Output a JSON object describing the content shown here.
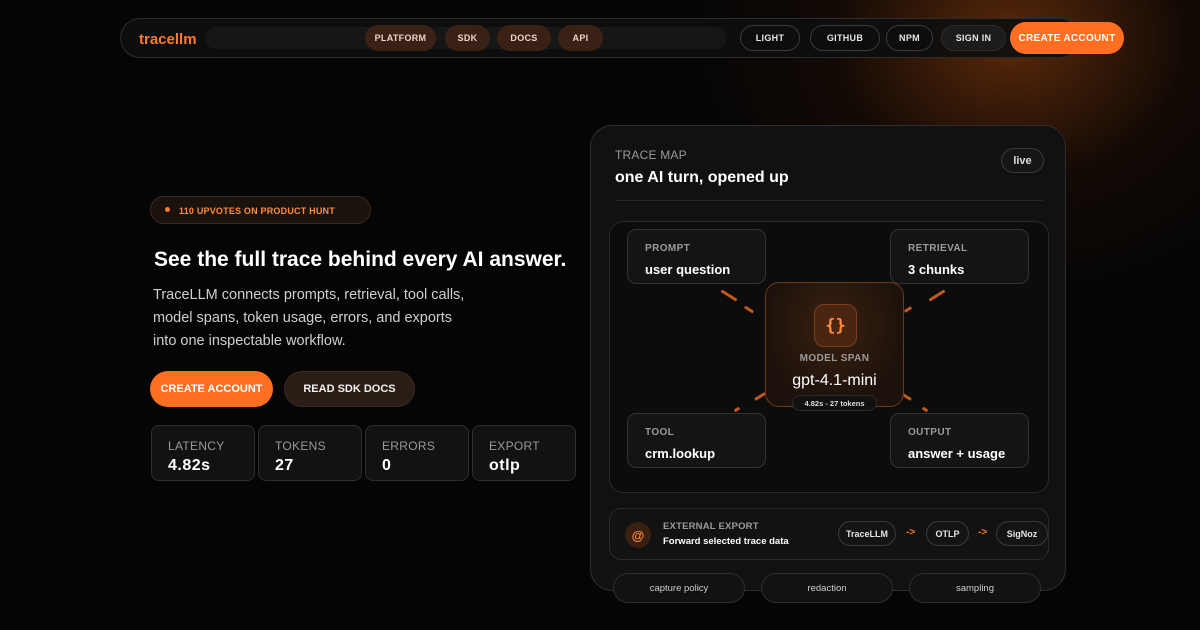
{
  "brand": "tracellm",
  "nav": {
    "links": [
      "PLATFORM",
      "SDK",
      "DOCS",
      "API"
    ],
    "light": "LIGHT",
    "github": "GITHUB",
    "npm": "NPM",
    "sign_in": "SIGN IN",
    "create_account": "CREATE ACCOUNT"
  },
  "hero": {
    "badge": "110 UPVOTES ON PRODUCT HUNT",
    "headline": "See the full trace behind every AI answer.",
    "subtitle_lines": [
      "TraceLLM connects prompts, retrieval, tool calls,",
      "model spans, token usage, errors, and exports",
      "into one inspectable workflow."
    ],
    "primary_cta": "CREATE ACCOUNT",
    "secondary_cta": "READ SDK DOCS"
  },
  "stats": [
    {
      "label": "LATENCY",
      "value": "4.82s"
    },
    {
      "label": "TOKENS",
      "value": "27"
    },
    {
      "label": "ERRORS",
      "value": "0"
    },
    {
      "label": "EXPORT",
      "value": "otlp"
    }
  ],
  "trace_card": {
    "kicker": "TRACE MAP",
    "title": "one AI turn, opened up",
    "status": "live",
    "nodes": {
      "prompt": {
        "label": "PROMPT",
        "value": "user question"
      },
      "retrieval": {
        "label": "RETRIEVAL",
        "value": "3 chunks"
      },
      "tool": {
        "label": "TOOL",
        "value": "crm.lookup"
      },
      "output": {
        "label": "OUTPUT",
        "value": "answer + usage"
      }
    },
    "model_span": {
      "icon": "{}",
      "label": "MODEL SPAN",
      "value": "gpt-4.1-mini",
      "meta": "4.82s - 27 tokens"
    },
    "export": {
      "label": "EXTERNAL EXPORT",
      "description": "Forward selected trace data",
      "pipeline": [
        "TraceLLM",
        "OTLP",
        "SigNoz"
      ],
      "arrow": "->"
    },
    "footer_tabs": [
      "capture policy",
      "redaction",
      "sampling"
    ]
  },
  "colors": {
    "accent": "#ff6f21",
    "background": "#050505",
    "card": "#111111"
  }
}
